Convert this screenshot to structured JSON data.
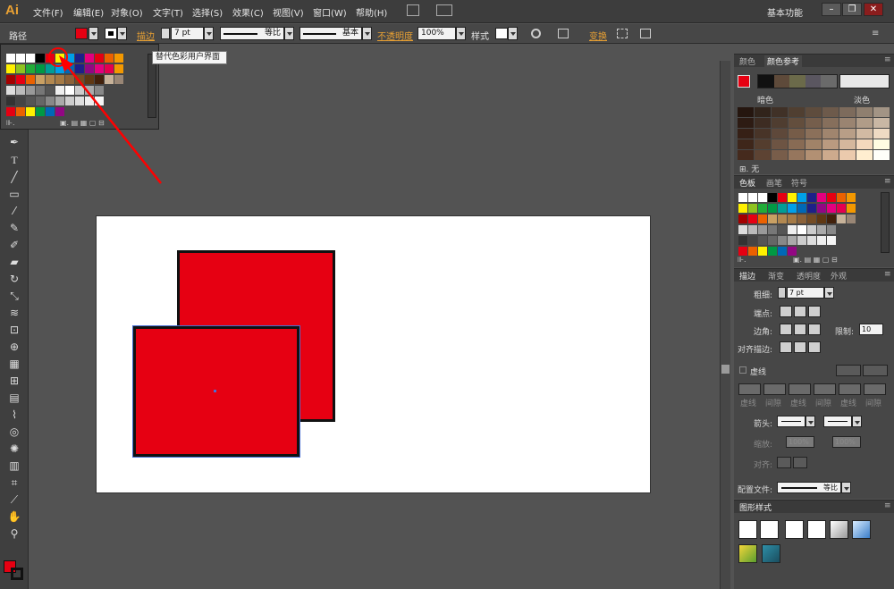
{
  "app": {
    "logo": "Ai"
  },
  "menu": [
    "文件(F)",
    "编辑(E)",
    "对象(O)",
    "文字(T)",
    "选择(S)",
    "效果(C)",
    "视图(V)",
    "窗口(W)",
    "帮助(H)"
  ],
  "workspace": "基本功能",
  "window_controls": [
    "–",
    "❐",
    "✕"
  ],
  "control": {
    "selection_label": "路径",
    "stroke_label": "描边",
    "stroke_weight": "7 pt",
    "profile_label": "等比",
    "brush_label": "基本",
    "opacity_label": "不透明度",
    "opacity_value": "100%",
    "style_label": "样式",
    "transform_label": "变换"
  },
  "tooltip": "替代色彩用户界面",
  "colors": {
    "fill": "#e60012",
    "accent": "#e8a033",
    "annotation": "#ff0000"
  },
  "color_guide": {
    "tabs": [
      "颜色",
      "颜色参考"
    ],
    "dark_label": "暗色",
    "light_label": "淡色",
    "footer_label": "无"
  },
  "swatches_panel": {
    "tabs": [
      "色板",
      "画笔",
      "符号"
    ]
  },
  "stroke_panel": {
    "tabs": [
      "描边",
      "渐变",
      "透明度",
      "外观"
    ],
    "weight_label": "粗细:",
    "weight_value": "7 pt",
    "cap_label": "端点:",
    "corner_label": "边角:",
    "limit_label": "限制:",
    "limit_value": "10",
    "align_label": "对齐描边:",
    "dashed_label": "虚线",
    "dash_labels": [
      "虚线",
      "间隙",
      "虚线",
      "间隙",
      "虚线",
      "间隙"
    ],
    "arrow_label": "箭头:",
    "scale_label": "缩放:",
    "scale_values": [
      "100%",
      "100%"
    ],
    "align2_label": "对齐:",
    "profile_label": "配置文件:",
    "profile_value": "等比"
  },
  "graphic_styles": {
    "tabs": [
      "图形样式"
    ]
  }
}
